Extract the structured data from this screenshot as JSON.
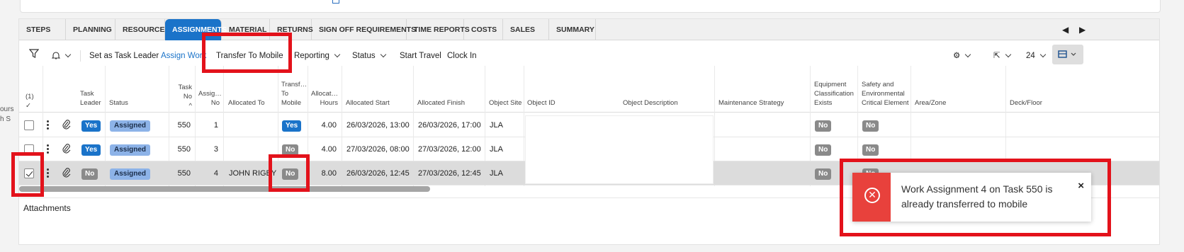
{
  "left_clip": [
    "ours",
    "h S"
  ],
  "tabs": [
    "STEPS",
    "PLANNING",
    "RESOURCES",
    "ASSIGNMENTS",
    "MATERIAL",
    "RETURNS",
    "SIGN OFF REQUIREMENTS",
    "TIME REPORTS",
    "COSTS",
    "SALES",
    "SUMMARY"
  ],
  "active_tab": "ASSIGNMENTS",
  "toolbar": {
    "set_task_leader": "Set as Task Leader",
    "assign_work": "Assign Work",
    "transfer_to_mobile": "Transfer To Mobile",
    "reporting": "Reporting",
    "status": "Status",
    "start_travel": "Start Travel",
    "clock_in": "Clock In",
    "page_size": "24"
  },
  "headers": {
    "select_count": "(1)",
    "task_leader": "Task\nLeader",
    "status": "Status",
    "task_no": "Task\nNo",
    "assignment_no": "Assig…\nNo",
    "allocated_to": "Allocated To",
    "transfer_to_mobile": "Transf…\nTo\nMobile",
    "allocated_hours": "Allocat…\nHours",
    "allocated_start": "Allocated Start",
    "allocated_finish": "Allocated Finish",
    "object_site": "Object Site",
    "object_id": "Object ID",
    "object_description": "Object Description",
    "maintenance_strategy": "Maintenance Strategy",
    "equipment_classification": "Equipment\nClassification\nExists",
    "safety_env": "Safety and\nEnvironmental\nCritical Element",
    "area_zone": "Area/Zone",
    "deck_floor": "Deck/Floor"
  },
  "rows": [
    {
      "checked": false,
      "task_leader": "Yes",
      "status": "Assigned",
      "task_no": "550",
      "assignment_no": "1",
      "allocated_to": "",
      "transfer": "Yes",
      "hours": "4.00",
      "start": "26/03/2026, 13:00",
      "finish": "26/03/2026, 17:00",
      "site": "JLA",
      "equip": "No",
      "safety": "No"
    },
    {
      "checked": false,
      "task_leader": "Yes",
      "status": "Assigned",
      "task_no": "550",
      "assignment_no": "3",
      "allocated_to": "",
      "transfer": "No",
      "hours": "4.00",
      "start": "27/03/2026, 08:00",
      "finish": "27/03/2026, 12:00",
      "site": "JLA",
      "equip": "No",
      "safety": "No"
    },
    {
      "checked": true,
      "task_leader": "No",
      "status": "Assigned",
      "task_no": "550",
      "assignment_no": "4",
      "allocated_to": "JOHN RIGBY",
      "transfer": "No",
      "hours": "8.00",
      "start": "26/03/2026, 12:45",
      "finish": "27/03/2026, 12:45",
      "site": "JLA",
      "equip": "No",
      "safety": "No"
    }
  ],
  "attachments_label": "Attachments",
  "toast": {
    "message": "Work Assignment 4 on Task 550 is already transferred to mobile",
    "close": "×",
    "icon": "error-circle-x-icon"
  },
  "colors": {
    "accent": "#1a73c9",
    "highlight": "#e3121b",
    "error": "#e8413c"
  }
}
